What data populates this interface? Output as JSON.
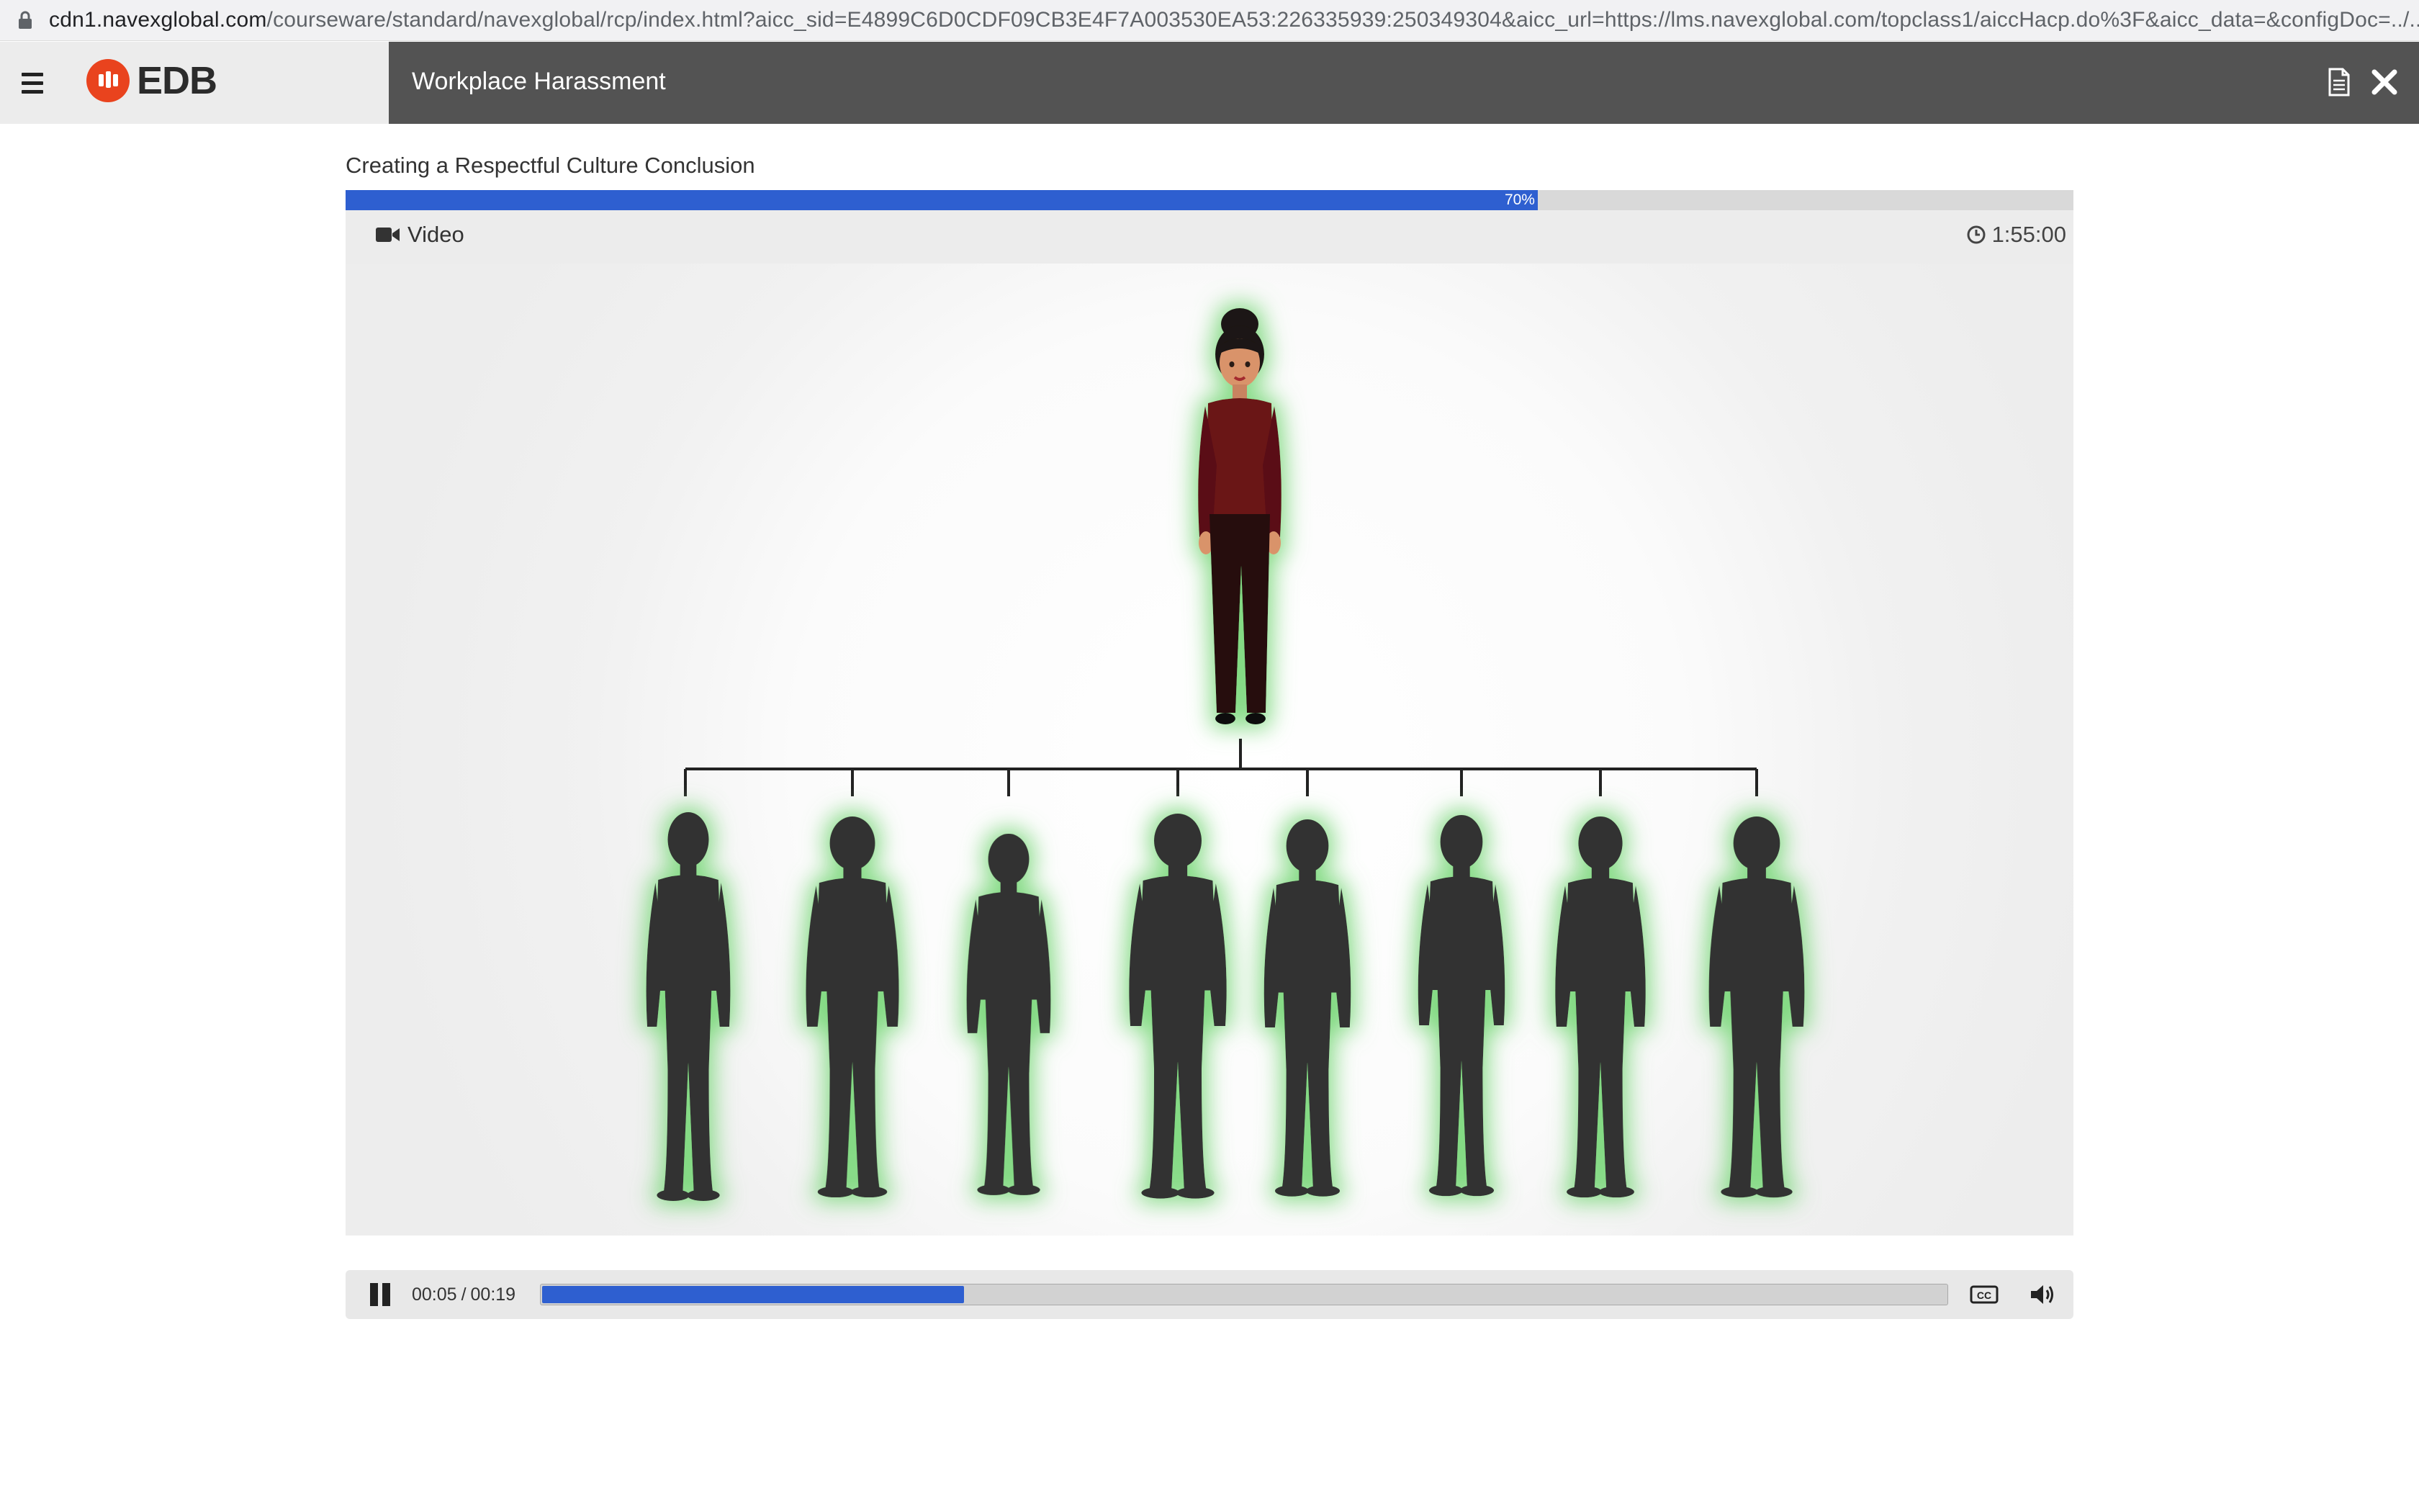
{
  "browser": {
    "url_host": "cdn1.navexglobal.com",
    "url_path": "/courseware/standard/navexglobal/rcp/index.html?aicc_sid=E4899C6D0CDF09CB3E4F7A003530EA53:226335939:250349304&aicc_url=https://lms.navexglobal.com/topclass1/aiccHacp.do%3F&aicc_data=&configDoc=../..."
  },
  "header": {
    "logo_text": "EDB",
    "course_title": "Workplace Harassment",
    "icons": [
      "menu-icon",
      "document-icon",
      "close-icon"
    ]
  },
  "lesson": {
    "title": "Creating a Respectful Culture Conclusion",
    "progress_percent": 70,
    "progress_label": "70%",
    "media_type": "Video",
    "duration": "1:55:00"
  },
  "player": {
    "current_time": "00:05",
    "separator": "/",
    "total_time": "00:19",
    "played_fraction": 0.3
  },
  "colors": {
    "accent_blue": "#2e5fd0",
    "course_bar": "#535353",
    "logo_red": "#e9431e",
    "glow_green": "#7dd87d",
    "silhouette": "#333333",
    "top_figure_shirt": "#6b1418"
  }
}
